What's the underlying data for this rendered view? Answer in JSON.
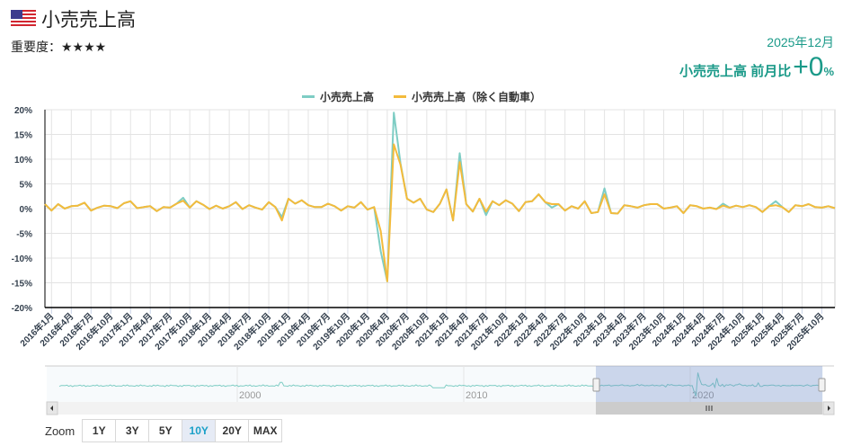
{
  "header": {
    "title": "小売売上高",
    "importance_label": "重要度：",
    "importance_stars": "★★★★",
    "period": "2025年12月",
    "change_label": "小売売上高 前月比",
    "change_value": "+0",
    "change_unit": "%"
  },
  "colors": {
    "series1": "#7ecdc4",
    "series2": "#f3bb3c",
    "accent": "#1b9a89"
  },
  "zoom": {
    "label": "Zoom",
    "buttons": [
      "1Y",
      "3Y",
      "5Y",
      "10Y",
      "20Y",
      "MAX"
    ],
    "active": "10Y"
  },
  "navigator": {
    "year_labels": [
      "2000",
      "2010",
      "2020"
    ]
  },
  "chart_data": {
    "type": "line",
    "start_month": "2015-12",
    "end_month": "2025-12",
    "ylim": [
      -20,
      20
    ],
    "yticks": [
      "20%",
      "15%",
      "10%",
      "5%",
      "0%",
      "-5%",
      "-10%",
      "-15%",
      "-20%"
    ],
    "ytick_values": [
      20,
      15,
      10,
      5,
      0,
      -5,
      -10,
      -15,
      -20
    ],
    "grid": true,
    "legend_position": "top-center",
    "xticks": [
      "2016年1月",
      "2016年4月",
      "2016年7月",
      "2016年10月",
      "2017年1月",
      "2017年4月",
      "2017年7月",
      "2017年10月",
      "2018年1月",
      "2018年4月",
      "2018年7月",
      "2018年10月",
      "2019年1月",
      "2019年4月",
      "2019年7月",
      "2019年10月",
      "2020年1月",
      "2020年4月",
      "2020年7月",
      "2020年10月",
      "2021年1月",
      "2021年4月",
      "2021年7月",
      "2021年10月",
      "2022年1月",
      "2022年4月",
      "2022年7月",
      "2022年10月",
      "2023年1月",
      "2023年4月",
      "2023年7月",
      "2023年10月",
      "2024年1月",
      "2024年4月",
      "2024年7月",
      "2024年10月",
      "2025年1月",
      "2025年4月",
      "2025年7月",
      "2025年10月"
    ],
    "series": [
      {
        "name": "小売売上高",
        "values": [
          0.9,
          -0.4,
          0.9,
          0,
          0.5,
          0.6,
          1.2,
          -0.4,
          0.2,
          0.6,
          0.5,
          0.1,
          1.1,
          1.5,
          0.1,
          0.3,
          0.5,
          -0.5,
          0.3,
          0.2,
          1.0,
          2.2,
          0.2,
          1.5,
          0.8,
          -0.1,
          0.6,
          0,
          0.5,
          1.3,
          -0.1,
          0.7,
          0.2,
          -0.2,
          1.3,
          0.3,
          -1.7,
          2.0,
          1.0,
          1.7,
          0.7,
          0.3,
          0.3,
          1.0,
          0.5,
          -0.4,
          0.5,
          0.2,
          1.3,
          -0.2,
          0.3,
          -8.6,
          -14.7,
          19.4,
          9.2,
          2.0,
          1.2,
          2.0,
          -0.2,
          -0.7,
          1.0,
          3.9,
          -2.4,
          11.2,
          0.9,
          -0.6,
          2.0,
          -1.3,
          1.5,
          0.7,
          1.7,
          1.0,
          -0.5,
          1.3,
          1.5,
          2.9,
          1.3,
          0.2,
          0.9,
          -0.4,
          0.5,
          0,
          1.5,
          -0.9,
          -0.7,
          4.1,
          -0.9,
          -1.0,
          0.7,
          0.5,
          0.2,
          0.7,
          0.9,
          0.9,
          0,
          0.2,
          0.5,
          -0.9,
          0.7,
          0.5,
          0,
          0.2,
          -0.1,
          1.0,
          0.2,
          0.6,
          0.3,
          0.7,
          0.3,
          -0.7,
          0.5,
          1.5,
          0.3,
          -0.7,
          0.7,
          0.5,
          0.9,
          0.3,
          0.2,
          0.5,
          0.1
        ]
      },
      {
        "name": "小売売上高（除く自動車）",
        "values": [
          0.9,
          -0.4,
          0.9,
          0,
          0.5,
          0.6,
          1.2,
          -0.4,
          0.2,
          0.6,
          0.5,
          0.1,
          1.1,
          1.5,
          0.1,
          0.3,
          0.5,
          -0.5,
          0.3,
          0.2,
          1.0,
          1.6,
          0.2,
          1.5,
          0.8,
          -0.1,
          0.6,
          0,
          0.5,
          1.3,
          -0.1,
          0.7,
          0.2,
          -0.2,
          1.3,
          0.3,
          -2.4,
          2.0,
          1.0,
          1.7,
          0.7,
          0.3,
          0.3,
          1.0,
          0.5,
          -0.4,
          0.5,
          0.2,
          1.3,
          -0.2,
          0.3,
          -4.5,
          -14.7,
          13.0,
          8.9,
          2.0,
          1.2,
          2.0,
          -0.2,
          -0.7,
          1.0,
          3.9,
          -2.4,
          9.4,
          0.9,
          -0.6,
          2.0,
          -0.6,
          1.5,
          0.7,
          1.7,
          1.0,
          -0.5,
          1.3,
          1.5,
          2.9,
          1.3,
          0.9,
          0.9,
          -0.4,
          0.5,
          0,
          1.5,
          -0.9,
          -0.7,
          2.9,
          -0.9,
          -1.0,
          0.7,
          0.5,
          0.2,
          0.7,
          0.9,
          0.9,
          0,
          0.2,
          0.5,
          -0.9,
          0.7,
          0.5,
          0,
          0.2,
          -0.1,
          0.6,
          0.2,
          0.6,
          0.3,
          0.7,
          0.3,
          -0.7,
          0.5,
          0.7,
          0.3,
          -0.7,
          0.7,
          0.5,
          0.9,
          0.3,
          0.2,
          0.5,
          0.1
        ]
      }
    ]
  }
}
